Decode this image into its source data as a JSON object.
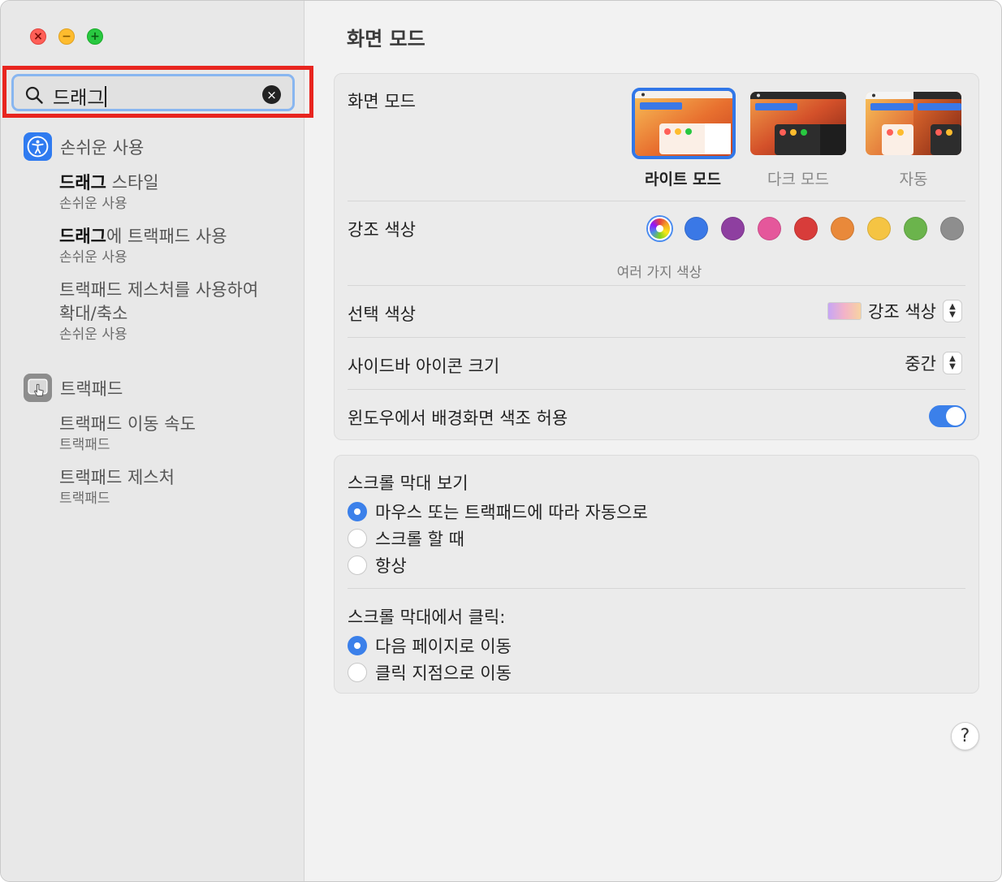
{
  "window_controls": {
    "close_glyph": "×",
    "minimize_glyph": "−",
    "zoom_glyph": "+"
  },
  "search": {
    "value": "드래그",
    "clear_glyph": "×"
  },
  "sidebar": {
    "categories": [
      {
        "label": "손쉬운 사용",
        "icon": "accessibility-icon",
        "results": [
          {
            "highlight": "드래그",
            "rest": " 스타일",
            "sub": "손쉬운 사용"
          },
          {
            "highlight": "드래그",
            "rest": "에 트랙패드 사용",
            "sub": "손쉬운 사용"
          },
          {
            "line1": "트랙패드 제스처를 사용하여",
            "line2": "확대/축소",
            "sub": "손쉬운 사용"
          }
        ]
      },
      {
        "label": "트랙패드",
        "icon": "trackpad-icon",
        "results": [
          {
            "title": "트랙패드 이동 속도",
            "sub": "트랙패드"
          },
          {
            "title": "트랙패드 제스처",
            "sub": "트랙패드"
          }
        ]
      }
    ]
  },
  "main": {
    "title": "화면 모드",
    "appearance": {
      "label": "화면 모드",
      "options": [
        {
          "label": "라이트 모드",
          "selected": true
        },
        {
          "label": "다크 모드",
          "selected": false
        },
        {
          "label": "자동",
          "selected": false
        }
      ]
    },
    "accent": {
      "label": "강조 색상",
      "caption": "여러 가지 색상",
      "colors": [
        "multicolor",
        "#3a78e6",
        "#8e3fa0",
        "#e5579b",
        "#d83c3a",
        "#e9893a",
        "#f5c443",
        "#6bb44c",
        "#8e8e8e"
      ]
    },
    "highlight": {
      "label": "선택 색상",
      "value": "강조 색상"
    },
    "sidebar_icon_size": {
      "label": "사이드바 아이콘 크기",
      "value": "중간"
    },
    "wallpaper_tint": {
      "label": "윈도우에서 배경화면 색조 허용",
      "on": true
    },
    "show_scroll_bars": {
      "label": "스크롤 막대 보기",
      "options": [
        {
          "label": "마우스 또는 트랙패드에 따라 자동으로",
          "selected": true
        },
        {
          "label": "스크롤 할 때",
          "selected": false
        },
        {
          "label": "항상",
          "selected": false
        }
      ]
    },
    "click_scroll_bar": {
      "label": "스크롤 막대에서 클릭:",
      "options": [
        {
          "label": "다음 페이지로 이동",
          "selected": true
        },
        {
          "label": "클릭 지점으로 이동",
          "selected": false
        }
      ]
    },
    "help_label": "?"
  }
}
